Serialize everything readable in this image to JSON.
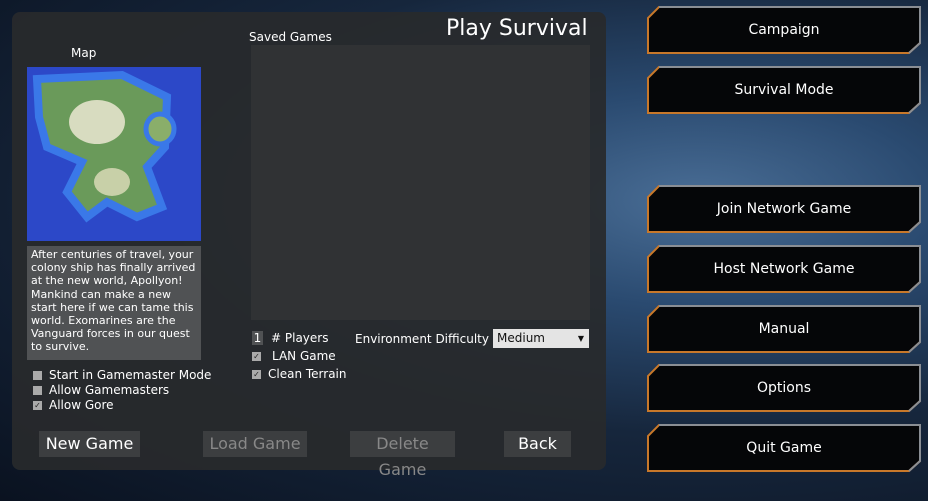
{
  "panel": {
    "title": "Play Survival",
    "map_label": "Map",
    "saved_games_label": "Saved Games",
    "description": "After centuries of travel, your colony ship has finally arrived at the new world, Apollyon! Mankind can make a new start here if we can tame this world. Exomarines are the Vanguard forces in our quest to survive.",
    "options": [
      {
        "label": "Start in Gamemaster Mode",
        "checked": false
      },
      {
        "label": "Allow Gamemasters",
        "checked": false
      },
      {
        "label": "Allow Gore",
        "checked": true
      }
    ],
    "players_value": "1",
    "players_label": "# Players",
    "lan_game": {
      "label": "LAN Game",
      "checked": true
    },
    "clean_terrain": {
      "label": "Clean Terrain",
      "checked": true
    },
    "difficulty_label": "Environment Difficulty",
    "difficulty_value": "Medium",
    "buttons": {
      "new": "New Game",
      "load": "Load Game",
      "delete": "Delete Game",
      "back": "Back"
    }
  },
  "menu": [
    {
      "label": "Campaign"
    },
    {
      "label": "Survival Mode"
    },
    {
      "label": "Join Network Game"
    },
    {
      "label": "Host Network Game"
    },
    {
      "label": "Manual"
    },
    {
      "label": "Options"
    },
    {
      "label": "Quit Game"
    }
  ],
  "colors": {
    "accent": "#c8782a",
    "panel": "#282a2c"
  }
}
